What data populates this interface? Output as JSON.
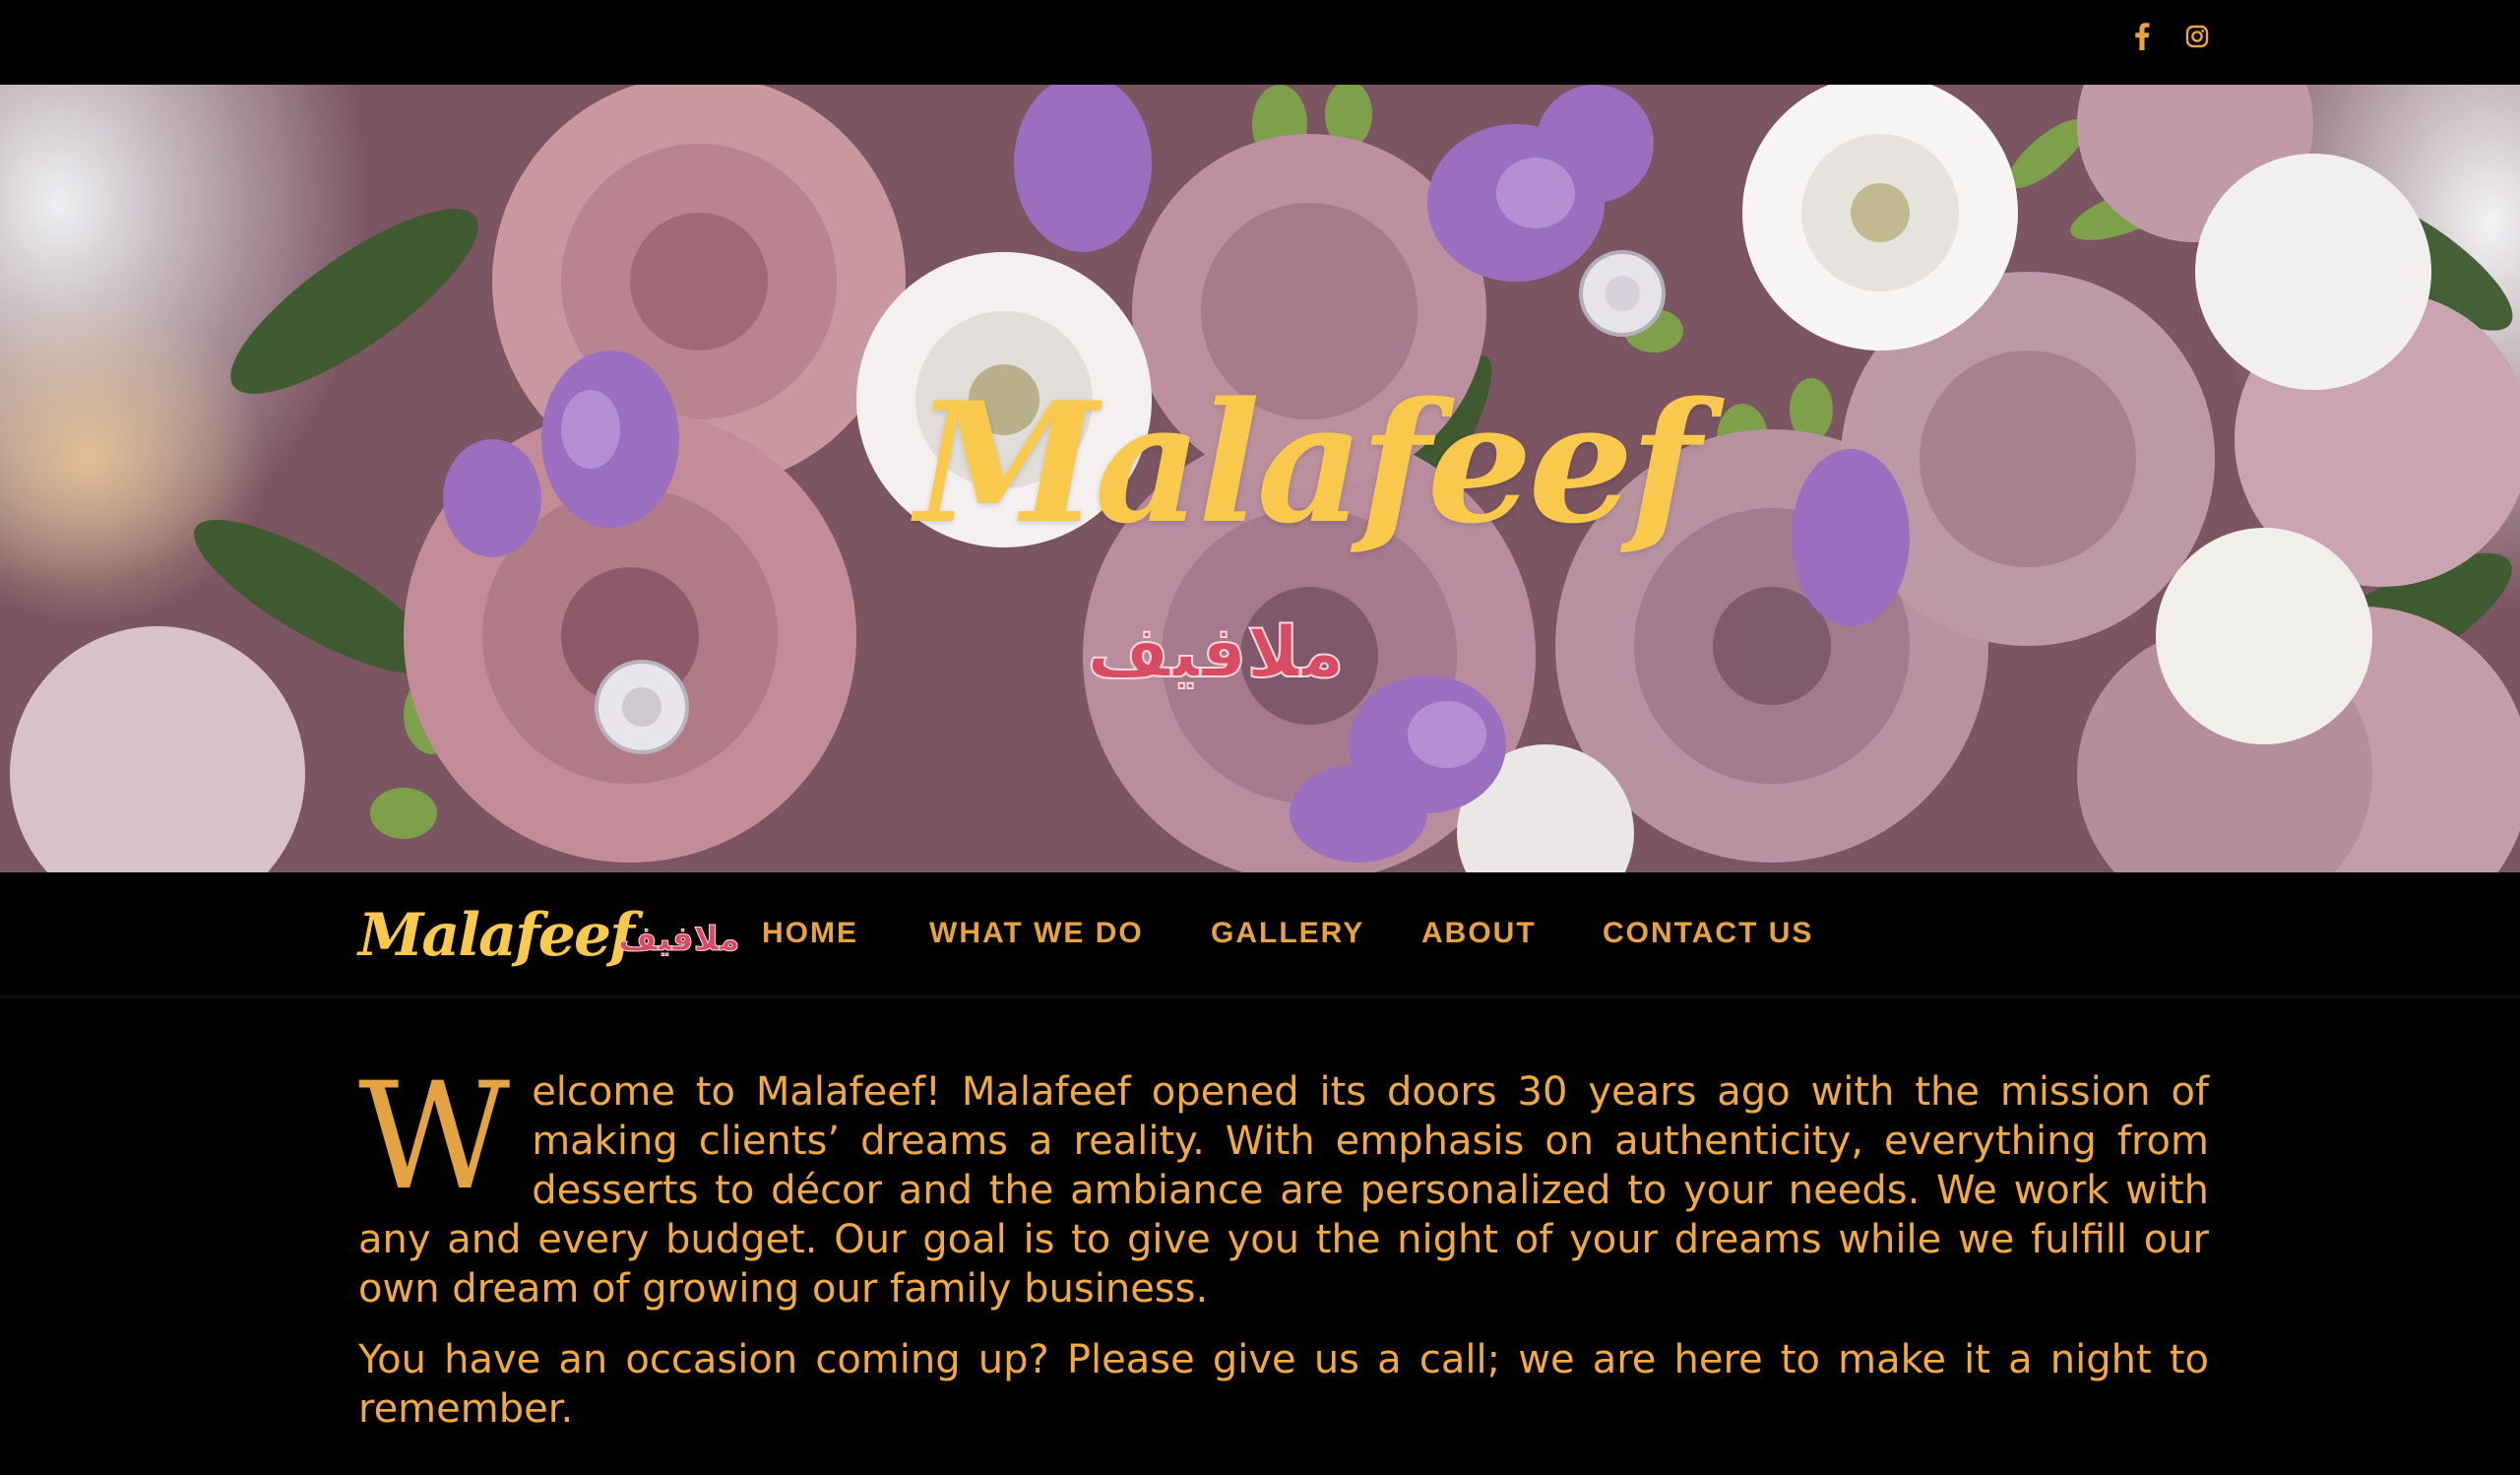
{
  "topbar": {
    "social": [
      {
        "icon": "facebook-icon"
      },
      {
        "icon": "instagram-icon"
      }
    ]
  },
  "hero": {
    "title": "Malafeef",
    "arabic": "ملافيف"
  },
  "nav": {
    "logo_text": "Malafeef",
    "logo_arabic": "ملافيف",
    "items": [
      "HOME",
      "WHAT WE DO",
      "GALLERY",
      "ABOUT",
      "CONTACT US"
    ]
  },
  "intro": {
    "dropcap": "W",
    "paragraph1_rest": "elcome to Malafeef! Malafeef opened its doors 30 years ago with the mission of making clients’ dreams a reality. With emphasis on authenticity, everything from desserts to décor and the ambiance are personalized to your needs. We work with any and every budget. Our goal is to give you the night of your dreams while we fulfill our own dream of growing our family business.",
    "paragraph2": "You have an occasion coming up?  Please give us a call; we are here to make it a night to remember."
  },
  "colors": {
    "accent": "#f2aa40",
    "logo_yellow": "#f9c94d",
    "logo_pink": "#d94a63",
    "background": "#000000"
  }
}
